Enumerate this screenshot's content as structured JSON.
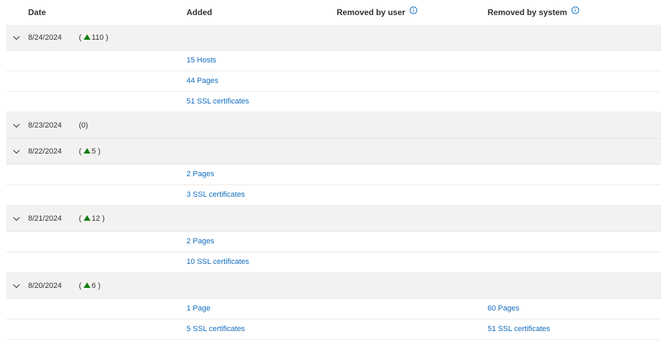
{
  "columns": {
    "date": "Date",
    "added": "Added",
    "removed_user": "Removed by user",
    "removed_system": "Removed by system"
  },
  "accent_color": "#0f6cbd",
  "increase_color": "#107c10",
  "groups": [
    {
      "date": "8/24/2024",
      "open": "(",
      "delta": "110",
      "close": ")",
      "increase": true,
      "rows": [
        {
          "added": "15 Hosts",
          "removed_user": "",
          "removed_system": ""
        },
        {
          "added": "44 Pages",
          "removed_user": "",
          "removed_system": ""
        },
        {
          "added": "51 SSL certificates",
          "removed_user": "",
          "removed_system": ""
        }
      ]
    },
    {
      "date": "8/23/2024",
      "open": "(",
      "delta": "0",
      "close": ")",
      "increase": false,
      "rows": []
    },
    {
      "date": "8/22/2024",
      "open": "(",
      "delta": "5",
      "close": ")",
      "increase": true,
      "rows": [
        {
          "added": "2 Pages",
          "removed_user": "",
          "removed_system": ""
        },
        {
          "added": "3 SSL certificates",
          "removed_user": "",
          "removed_system": ""
        }
      ]
    },
    {
      "date": "8/21/2024",
      "open": "(",
      "delta": "12",
      "close": ")",
      "increase": true,
      "rows": [
        {
          "added": "2 Pages",
          "removed_user": "",
          "removed_system": ""
        },
        {
          "added": "10 SSL certificates",
          "removed_user": "",
          "removed_system": ""
        }
      ]
    },
    {
      "date": "8/20/2024",
      "open": "(",
      "delta": "6",
      "close": ")",
      "increase": true,
      "rows": [
        {
          "added": "1 Page",
          "removed_user": "",
          "removed_system": "60 Pages"
        },
        {
          "added": "5 SSL certificates",
          "removed_user": "",
          "removed_system": "51 SSL certificates"
        }
      ]
    }
  ]
}
